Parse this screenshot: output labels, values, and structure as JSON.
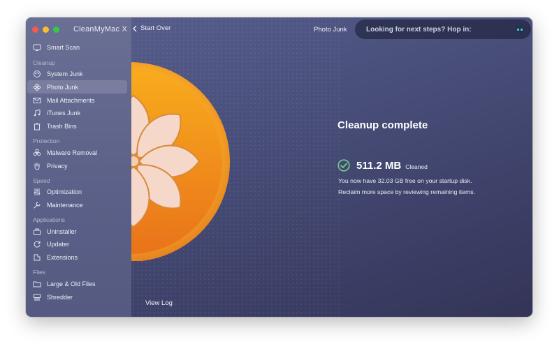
{
  "app": {
    "title": "CleanMyMac X"
  },
  "header": {
    "back_label": "Start Over",
    "module_title": "Photo Junk",
    "hop_text": "Looking for next steps? Hop in:"
  },
  "sidebar": {
    "top_item": {
      "label": "Smart Scan",
      "icon": "smart-scan-icon"
    },
    "sections": [
      {
        "title": "Cleanup",
        "items": [
          {
            "label": "System Junk",
            "icon": "system-junk-icon"
          },
          {
            "label": "Photo Junk",
            "icon": "photo-junk-icon",
            "selected": true
          },
          {
            "label": "Mail Attachments",
            "icon": "mail-icon"
          },
          {
            "label": "iTunes Junk",
            "icon": "music-note-icon"
          },
          {
            "label": "Trash Bins",
            "icon": "trash-icon"
          }
        ]
      },
      {
        "title": "Protection",
        "items": [
          {
            "label": "Malware Removal",
            "icon": "biohazard-icon"
          },
          {
            "label": "Privacy",
            "icon": "hand-icon"
          }
        ]
      },
      {
        "title": "Speed",
        "items": [
          {
            "label": "Optimization",
            "icon": "sliders-icon"
          },
          {
            "label": "Maintenance",
            "icon": "wrench-icon"
          }
        ]
      },
      {
        "title": "Applications",
        "items": [
          {
            "label": "Uninstaller",
            "icon": "uninstaller-icon"
          },
          {
            "label": "Updater",
            "icon": "updater-icon"
          },
          {
            "label": "Extensions",
            "icon": "extensions-icon"
          }
        ]
      },
      {
        "title": "Files",
        "items": [
          {
            "label": "Large & Old Files",
            "icon": "folder-icon"
          },
          {
            "label": "Shredder",
            "icon": "shredder-icon"
          }
        ]
      }
    ]
  },
  "main": {
    "title": "Cleanup complete",
    "size": "511.2 MB",
    "size_suffix": "Cleaned",
    "info_line_1": "You now have 32.03 GB free on your startup disk.",
    "info_line_2": "Reclaim more space by reviewing remaining items.",
    "view_log": "View Log"
  },
  "colors": {
    "accent_orange": "#f39a12",
    "check_green": "#6fd18a",
    "window_bg": "#474d78"
  }
}
